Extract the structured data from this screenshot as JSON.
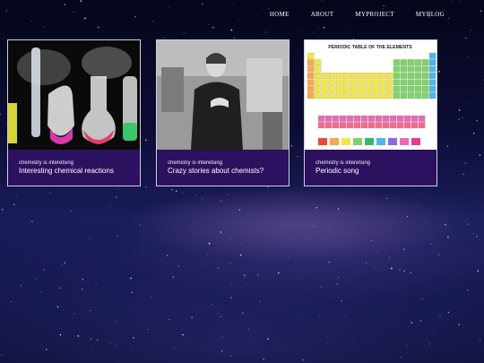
{
  "nav": {
    "items": [
      "HOME",
      "ABOUT",
      "MYPROJECT",
      "MYBLOG"
    ]
  },
  "cards": [
    {
      "tag": "chemistry is interetsing",
      "title": "Interesting chemical reactions",
      "image": "chemistry-glassware"
    },
    {
      "tag": "chemistry is interetsing",
      "title": "Crazy stories about chemists?",
      "image": "chemist-portrait"
    },
    {
      "tag": "chemistry is interetsing",
      "title": "Periodic song",
      "image": "periodic-table",
      "image_text": "PERIODIC TABLE OF THE ELEMENTS"
    }
  ]
}
